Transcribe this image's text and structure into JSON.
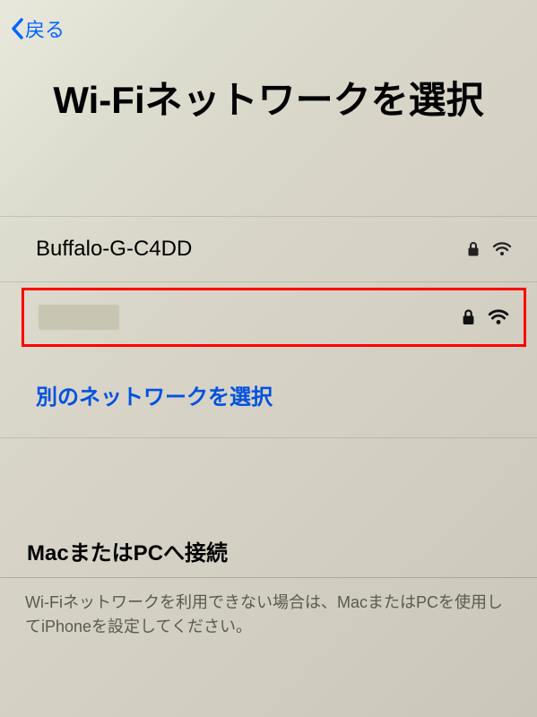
{
  "header": {
    "back_label": "戻る"
  },
  "title": "Wi-Fiネットワークを選択",
  "networks": [
    {
      "name": "Buffalo-G-C4DD",
      "secured": true,
      "signal": 2
    },
    {
      "name": "",
      "secured": true,
      "signal": 3,
      "blurred": true
    }
  ],
  "other_network_label": "別のネットワークを選択",
  "footer": {
    "title": "MacまたはPCへ接続",
    "description": "Wi-Fiネットワークを利用できない場合は、MacまたはPCを使用してiPhoneを設定してください。"
  }
}
